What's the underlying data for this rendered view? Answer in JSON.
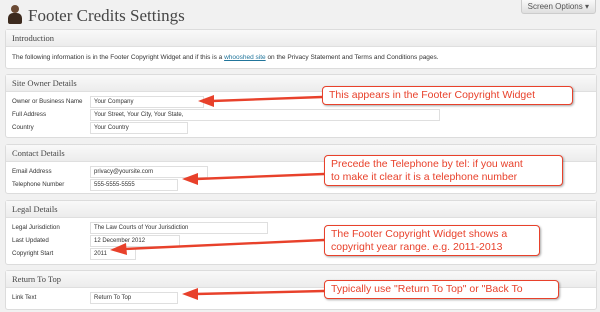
{
  "header": {
    "title": "Footer Credits Settings",
    "screen_options_label": "Screen Options ▾"
  },
  "sections": {
    "intro": {
      "heading": "Introduction",
      "text_before": "The following information is in the Footer Copyright Widget and if this is a ",
      "link_text": "whooshed site",
      "text_after": " on the Privacy Statement and Terms and Conditions pages."
    },
    "owner": {
      "heading": "Site Owner Details",
      "fields": [
        {
          "label": "Owner or Business Name",
          "value": "Your Company"
        },
        {
          "label": "Full Address",
          "value": "Your Street, Your City, Your State,"
        },
        {
          "label": "Country",
          "value": "Your Country"
        }
      ]
    },
    "contact": {
      "heading": "Contact Details",
      "fields": [
        {
          "label": "Email Address",
          "value": "privacy@yoursite.com"
        },
        {
          "label": "Telephone Number",
          "value": "555-5555-5555"
        }
      ]
    },
    "legal": {
      "heading": "Legal Details",
      "fields": [
        {
          "label": "Legal Jurisdiction",
          "value": "The Law Courts of Your Jurisdiction"
        },
        {
          "label": "Last Updated",
          "value": "12 December 2012"
        },
        {
          "label": "Copyright Start",
          "value": "2011"
        }
      ]
    },
    "return_to_top": {
      "heading": "Return To Top",
      "fields": [
        {
          "label": "Link Text",
          "value": "Return To Top"
        }
      ]
    }
  },
  "callouts": [
    {
      "text": "This appears in the Footer Copyright Widget"
    },
    {
      "line1": "Precede the Telephone by tel: if you want",
      "line2": "to make it clear it is a telephone number"
    },
    {
      "line1": "The Footer Copyright Widget shows a",
      "line2": "copyright year range. e.g. 2011-2013"
    },
    {
      "text": "Typically use \"Return To Top\" or \"Back To"
    }
  ],
  "colors": {
    "annotation": "#e8412b",
    "link": "#21759b",
    "background": "#f1f1f1"
  }
}
